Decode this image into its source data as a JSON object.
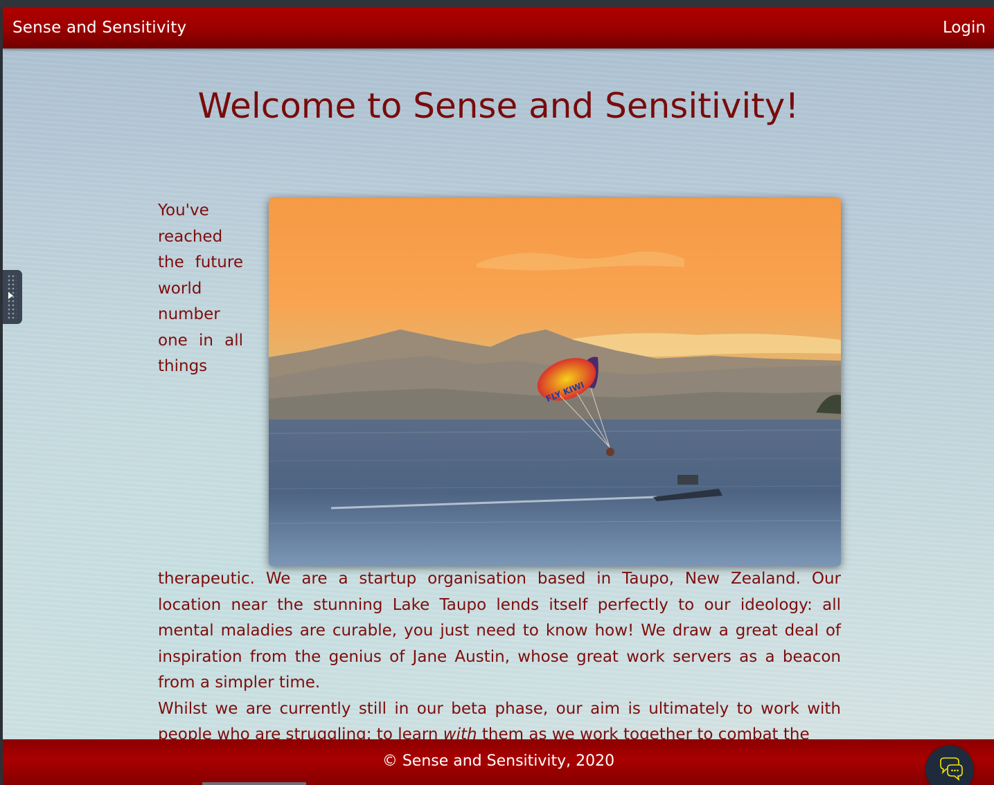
{
  "navbar": {
    "brand": "Sense and Sensitivity",
    "login_label": "Login"
  },
  "main": {
    "title": "Welcome to Sense and Sensitivity!",
    "intro": "You've reached the future world number one in all things therapeutic. We are a startup organisation based in Taupo, New Zealand. Our location near the stunning Lake Taupo lends itself perfectly to our ideology: all mental maladies are curable, you just need to know how! We draw a great deal of inspiration from the genius of Jane Austin, whose great work servers as a beacon from a simpler time.",
    "second_before": "Whilst we are currently still in our beta phase, our aim is ultimately to work with people who are struggling: to learn ",
    "second_emphasis": "with",
    "second_after": " them as we work together to combat the",
    "photo_description": "parasailing on lake at sunset",
    "parasail_text": "FLY KIWI"
  },
  "footer": {
    "copyright": "© Sense and Sensitivity, 2020"
  },
  "icons": {
    "chat": "chat-bubbles-icon",
    "side_handle": "play-icon"
  },
  "colors": {
    "brand_red": "#9a0000",
    "text_red": "#7d0d0d",
    "title_red": "#780b0b",
    "chat_button": "#1f2b3c"
  }
}
